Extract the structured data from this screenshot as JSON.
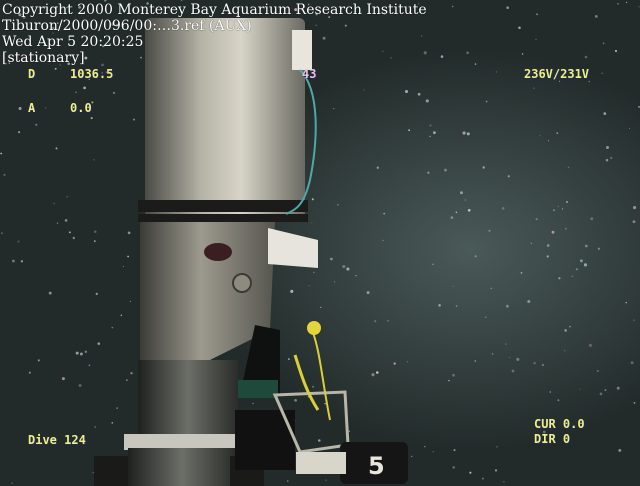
{
  "overlay": {
    "line1": "Copyright 2000 Monterey Bay Aquarium Research Institute",
    "line2": "Tiburon/2000/096/00:…3.ref (AUX)",
    "line3": "Wed Apr  5 20:20:25",
    "line4": "[stationary]"
  },
  "hud": {
    "depth_label": "D",
    "depth_value": "1036.5",
    "alt_label": "A",
    "alt_value": "0.0",
    "heading_value": "43",
    "voltage": "236V/231V",
    "dive": "Dive 124",
    "cur": "CUR 0.0",
    "dir": "DIR 0"
  },
  "label_on_bottle": "5",
  "colors": {
    "hud_text": "#f1f07a",
    "overlay_text": "#ffffff",
    "water": "#34403f"
  }
}
